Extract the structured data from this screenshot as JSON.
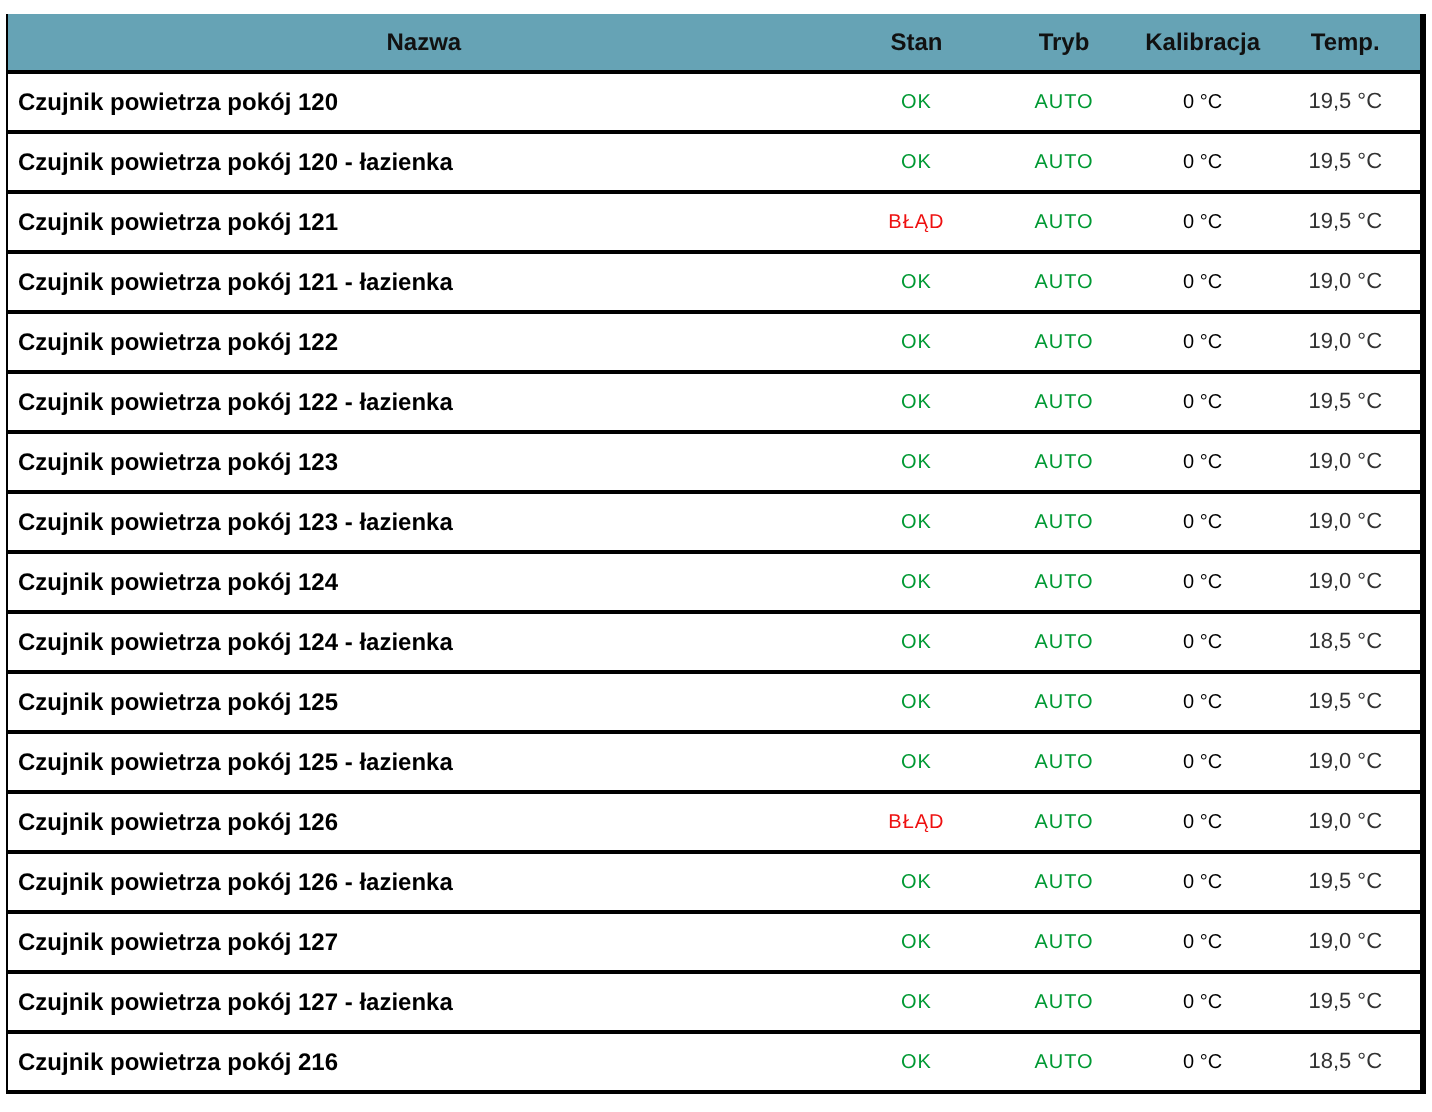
{
  "table": {
    "columns": [
      "Nazwa",
      "Stan",
      "Tryb",
      "Kalibracja",
      "Temp."
    ],
    "rows": [
      {
        "name": "Czujnik powietrza pokój 120",
        "status": {
          "text": "OK",
          "color": "#009933"
        },
        "mode": "AUTO",
        "calibration": "0 °C",
        "temp": "19,5 °C"
      },
      {
        "name": "Czujnik powietrza pokój 120 - łazienka",
        "status": {
          "text": "OK",
          "color": "#009933"
        },
        "mode": "AUTO",
        "calibration": "0 °C",
        "temp": "19,5 °C"
      },
      {
        "name": "Czujnik powietrza pokój 121",
        "status": {
          "text": "BŁĄD",
          "color": "#ee1111"
        },
        "mode": "AUTO",
        "calibration": "0 °C",
        "temp": "19,5 °C"
      },
      {
        "name": "Czujnik powietrza pokój 121 - łazienka",
        "status": {
          "text": "OK",
          "color": "#009933"
        },
        "mode": "AUTO",
        "calibration": "0 °C",
        "temp": "19,0 °C"
      },
      {
        "name": "Czujnik powietrza pokój 122",
        "status": {
          "text": "OK",
          "color": "#009933"
        },
        "mode": "AUTO",
        "calibration": "0 °C",
        "temp": "19,0 °C"
      },
      {
        "name": "Czujnik powietrza pokój 122 - łazienka",
        "status": {
          "text": "OK",
          "color": "#009933"
        },
        "mode": "AUTO",
        "calibration": "0 °C",
        "temp": "19,5 °C"
      },
      {
        "name": "Czujnik powietrza pokój 123",
        "status": {
          "text": "OK",
          "color": "#009933"
        },
        "mode": "AUTO",
        "calibration": "0 °C",
        "temp": "19,0 °C"
      },
      {
        "name": "Czujnik powietrza pokój 123 - łazienka",
        "status": {
          "text": "OK",
          "color": "#009933"
        },
        "mode": "AUTO",
        "calibration": "0 °C",
        "temp": "19,0 °C"
      },
      {
        "name": "Czujnik powietrza pokój 124",
        "status": {
          "text": "OK",
          "color": "#009933"
        },
        "mode": "AUTO",
        "calibration": "0 °C",
        "temp": "19,0 °C"
      },
      {
        "name": "Czujnik powietrza pokój 124 - łazienka",
        "status": {
          "text": "OK",
          "color": "#009933"
        },
        "mode": "AUTO",
        "calibration": "0 °C",
        "temp": "18,5 °C"
      },
      {
        "name": "Czujnik powietrza pokój 125",
        "status": {
          "text": "OK",
          "color": "#009933"
        },
        "mode": "AUTO",
        "calibration": "0 °C",
        "temp": "19,5 °C"
      },
      {
        "name": "Czujnik powietrza pokój 125 - łazienka",
        "status": {
          "text": "OK",
          "color": "#009933"
        },
        "mode": "AUTO",
        "calibration": "0 °C",
        "temp": "19,0 °C"
      },
      {
        "name": "Czujnik powietrza pokój 126",
        "status": {
          "text": "BŁĄD",
          "color": "#ee1111"
        },
        "mode": "AUTO",
        "calibration": "0 °C",
        "temp": "19,0 °C"
      },
      {
        "name": "Czujnik powietrza pokój 126 - łazienka",
        "status": {
          "text": "OK",
          "color": "#009933"
        },
        "mode": "AUTO",
        "calibration": "0 °C",
        "temp": "19,5 °C"
      },
      {
        "name": "Czujnik powietrza pokój 127",
        "status": {
          "text": "OK",
          "color": "#009933"
        },
        "mode": "AUTO",
        "calibration": "0 °C",
        "temp": "19,0 °C"
      },
      {
        "name": "Czujnik powietrza pokój 127 - łazienka",
        "status": {
          "text": "OK",
          "color": "#009933"
        },
        "mode": "AUTO",
        "calibration": "0 °C",
        "temp": "19,5 °C"
      },
      {
        "name": "Czujnik powietrza pokój 216",
        "status": {
          "text": "OK",
          "color": "#009933"
        },
        "mode": "AUTO",
        "calibration": "0 °C",
        "temp": "18,5 °C"
      }
    ]
  }
}
